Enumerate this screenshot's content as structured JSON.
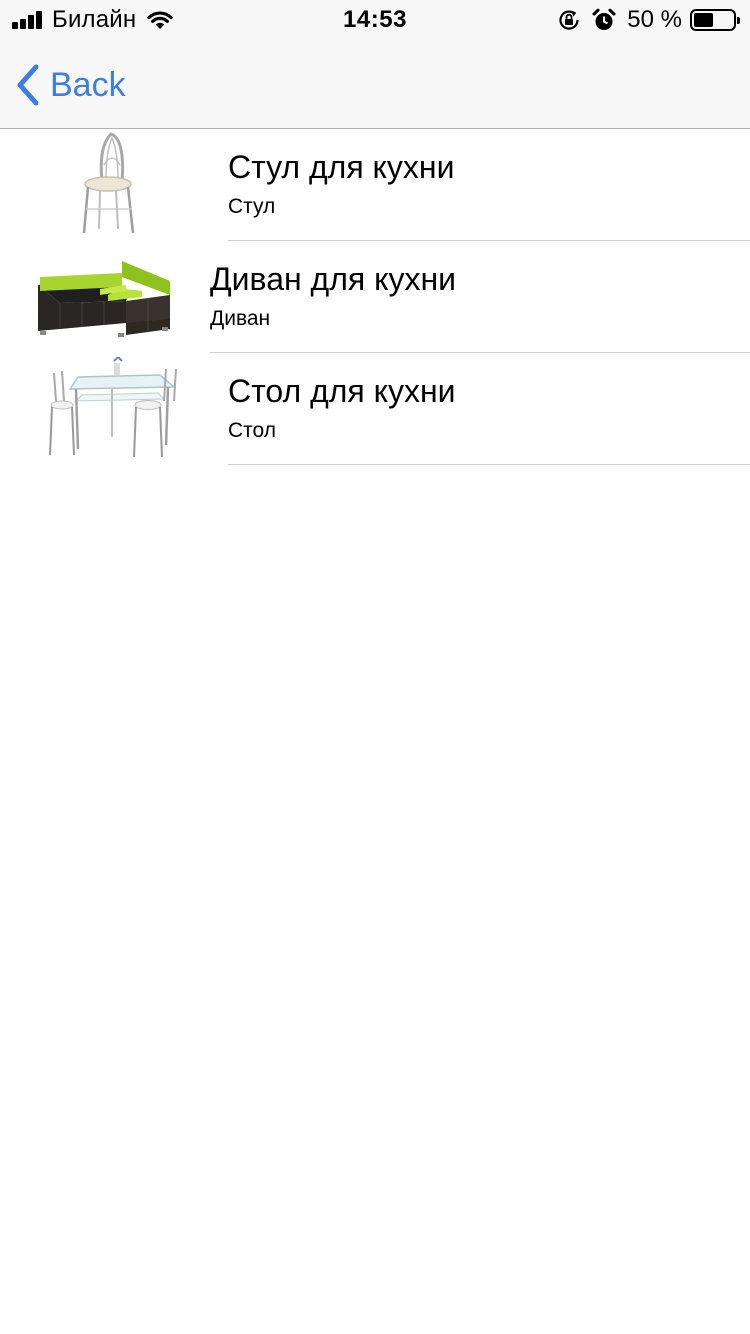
{
  "status_bar": {
    "carrier": "Билайн",
    "time": "14:53",
    "battery_percent_text": "50 %",
    "battery_level": 0.5,
    "icons": [
      "signal-icon",
      "wifi-icon",
      "orientation-lock-icon",
      "alarm-icon",
      "battery-icon"
    ]
  },
  "nav": {
    "back_label": "Back",
    "tint": "#3a7fe5"
  },
  "items": [
    {
      "title": "Стул для кухни",
      "subtitle": "Стул",
      "image": "chair-image"
    },
    {
      "title": "Диван для кухни",
      "subtitle": "Диван",
      "image": "corner-sofa-image"
    },
    {
      "title": "Стол для кухни",
      "subtitle": "Стол",
      "image": "table-set-image"
    }
  ]
}
